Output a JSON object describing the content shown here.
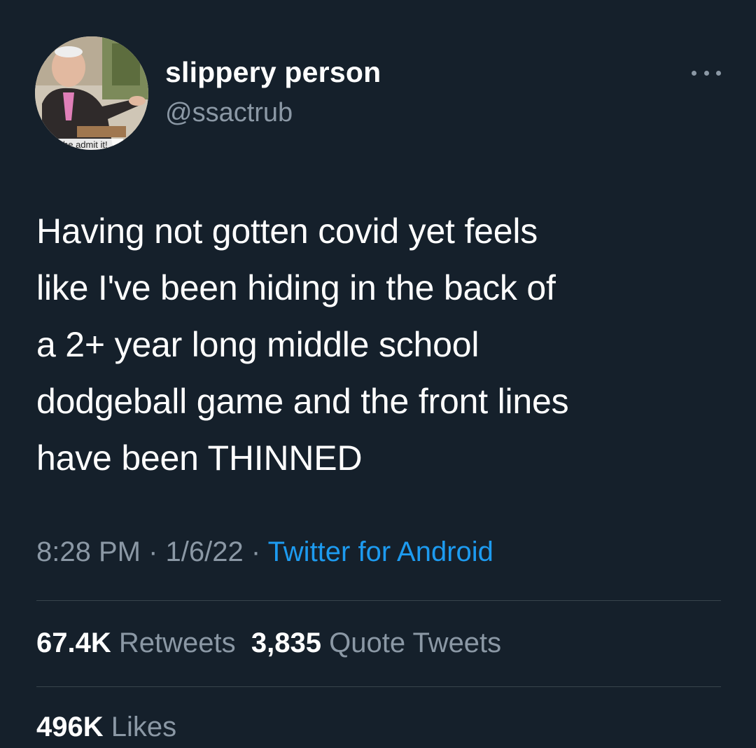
{
  "author": {
    "display_name": "slippery person",
    "handle": "@ssactrub",
    "avatar_caption": "he admit it!"
  },
  "menu": {
    "icon": "more-horizontal-icon"
  },
  "tweet": {
    "text": "Having not gotten covid yet feels\nlike I've been hiding in the back of\na 2+ year long middle school\ndodgeball game and the front lines\nhave been THINNED"
  },
  "meta": {
    "time": "8:28 PM",
    "separator": " · ",
    "date": "1/6/22",
    "source": "Twitter for Android"
  },
  "stats": {
    "retweets_count": "67.4K",
    "retweets_label": "Retweets",
    "quotes_count": "3,835",
    "quotes_label": "Quote Tweets",
    "likes_count": "496K",
    "likes_label": "Likes"
  },
  "colors": {
    "background": "#15202b",
    "primary_text": "#ffffff",
    "secondary_text": "#8b98a5",
    "link": "#1d9bf0",
    "divider": "#38444d"
  }
}
